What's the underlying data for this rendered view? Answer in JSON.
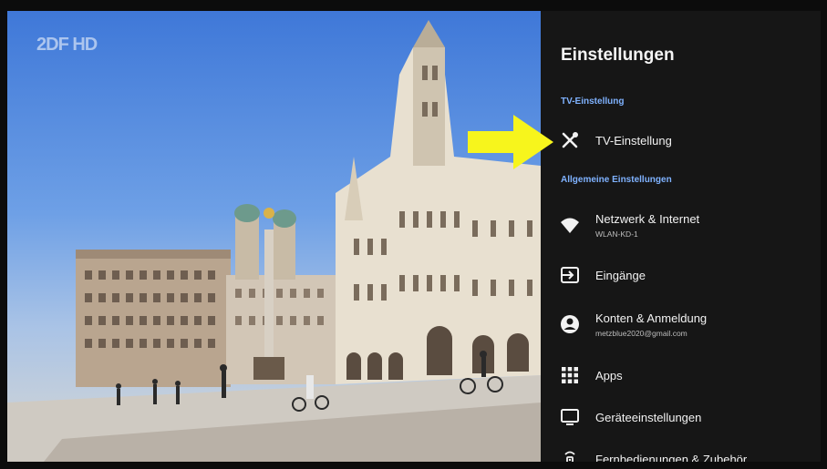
{
  "channel": {
    "logo_text": "2DF HD"
  },
  "settings": {
    "title": "Einstellungen",
    "sections": [
      {
        "header": "TV-Einstellung"
      },
      {
        "header": "Allgemeine Einstellungen"
      }
    ],
    "items": [
      {
        "label": "TV-Einstellung",
        "icon": "tools-icon"
      },
      {
        "label": "Netzwerk & Internet",
        "sublabel": "WLAN-KD-1",
        "icon": "wifi-icon"
      },
      {
        "label": "Eingänge",
        "icon": "input-icon"
      },
      {
        "label": "Konten & Anmeldung",
        "sublabel": "metzblue2020@gmail.com",
        "icon": "account-icon"
      },
      {
        "label": "Apps",
        "icon": "apps-grid-icon"
      },
      {
        "label": "Geräteeinstellungen",
        "icon": "tv-monitor-icon"
      },
      {
        "label": "Fernbedienungen & Zubehör",
        "icon": "remote-icon"
      }
    ]
  },
  "annotation": {
    "arrow_color": "#f7f51c"
  },
  "colors": {
    "panel_bg": "#161616",
    "section_header": "#7fb2ff",
    "text": "#f2f2f2"
  }
}
